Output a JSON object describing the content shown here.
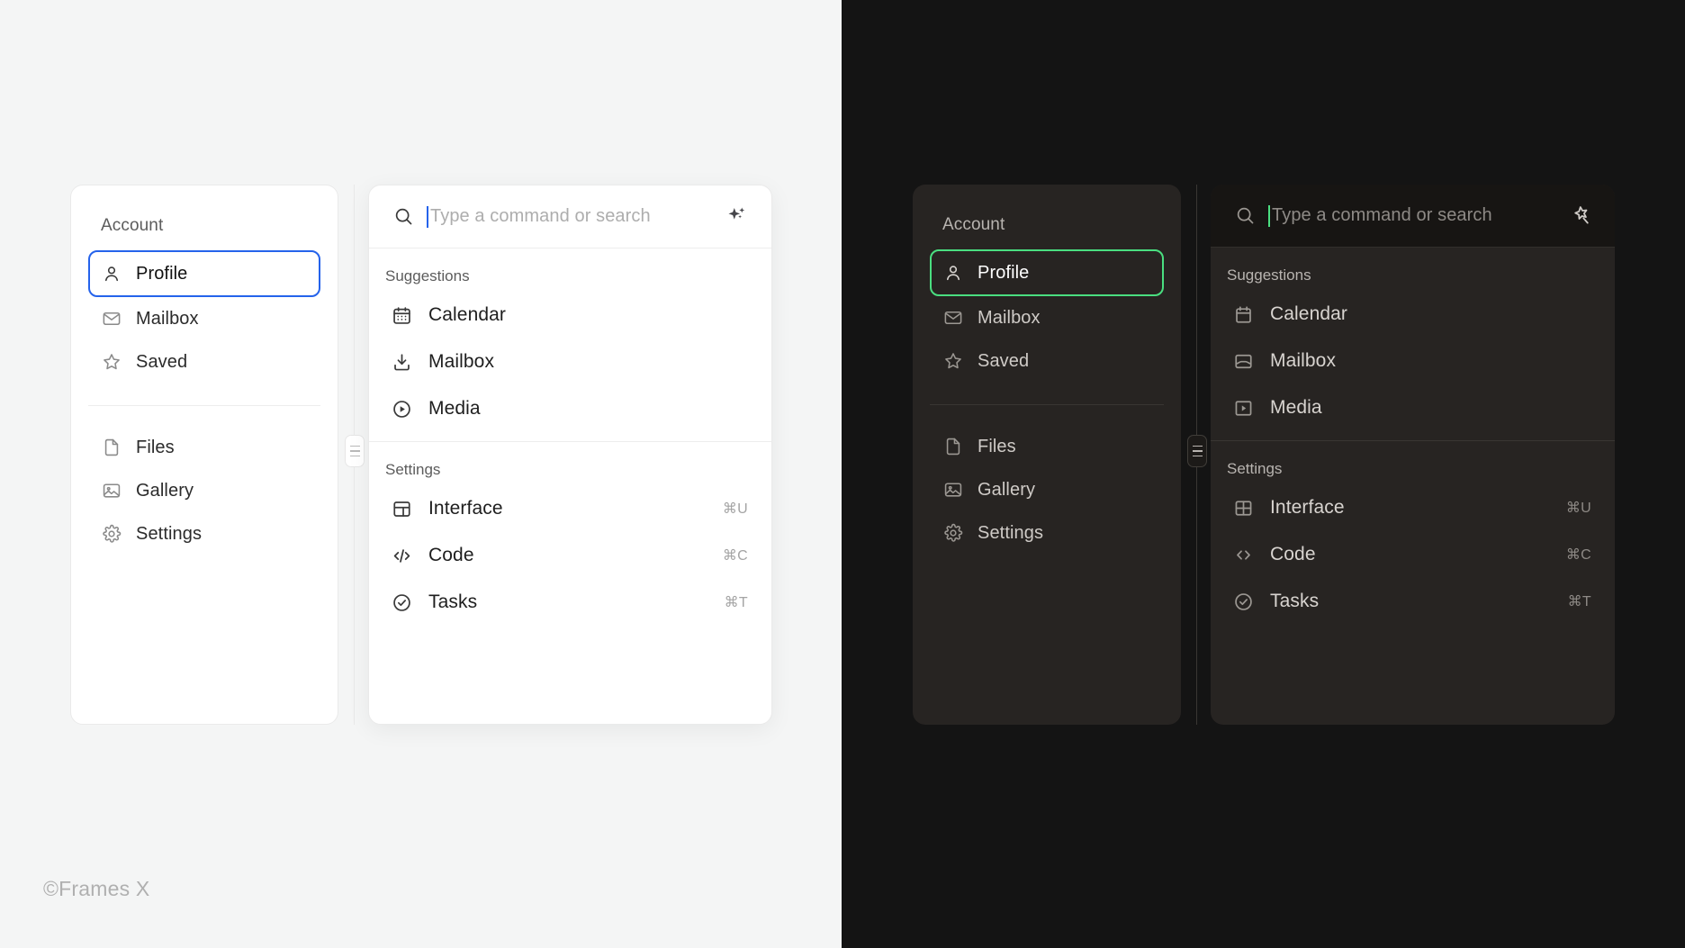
{
  "panels": {
    "light": {
      "theme_name": "light",
      "accent": "#2563EB",
      "background": "#F4F5F5",
      "sidebar": {
        "title": "Account",
        "group_a": [
          {
            "label": "Profile",
            "icon": "user-icon",
            "selected": true
          },
          {
            "label": "Mailbox",
            "icon": "envelope-icon",
            "selected": false
          },
          {
            "label": "Saved",
            "icon": "star-icon",
            "selected": false
          }
        ],
        "group_b": [
          {
            "label": "Files",
            "icon": "file-icon"
          },
          {
            "label": "Gallery",
            "icon": "image-icon"
          },
          {
            "label": "Settings",
            "icon": "gear-icon"
          }
        ]
      },
      "command": {
        "search_placeholder": "Type a command or search",
        "search_value": "",
        "search_icon": "search-icon",
        "action_icon": "sparkles-icon",
        "groups": [
          {
            "heading": "Suggestions",
            "items": [
              {
                "label": "Calendar",
                "icon": "calendar-icon",
                "shortcut": ""
              },
              {
                "label": "Mailbox",
                "icon": "download-icon",
                "shortcut": ""
              },
              {
                "label": "Media",
                "icon": "play-circle-icon",
                "shortcut": ""
              }
            ]
          },
          {
            "heading": "Settings",
            "items": [
              {
                "label": "Interface",
                "icon": "layout-icon",
                "shortcut": "⌘U"
              },
              {
                "label": "Code",
                "icon": "code-icon",
                "shortcut": "⌘C"
              },
              {
                "label": "Tasks",
                "icon": "check-circle-icon",
                "shortcut": "⌘T"
              }
            ]
          }
        ]
      },
      "resize_handle": "drag-handle-icon"
    },
    "dark": {
      "theme_name": "dark",
      "accent": "#4ADE80",
      "background": "#141414",
      "sidebar": {
        "title": "Account",
        "group_a": [
          {
            "label": "Profile",
            "icon": "user-icon",
            "selected": true
          },
          {
            "label": "Mailbox",
            "icon": "envelope-icon",
            "selected": false
          },
          {
            "label": "Saved",
            "icon": "star-icon",
            "selected": false
          }
        ],
        "group_b": [
          {
            "label": "Files",
            "icon": "file-icon"
          },
          {
            "label": "Gallery",
            "icon": "image-icon"
          },
          {
            "label": "Settings",
            "icon": "gear-icon"
          }
        ]
      },
      "command": {
        "search_placeholder": "Type a command or search",
        "search_value": "",
        "search_icon": "search-icon",
        "action_icon": "magic-star-icon",
        "groups": [
          {
            "heading": "Suggestions",
            "items": [
              {
                "label": "Calendar",
                "icon": "calendar-icon",
                "shortcut": ""
              },
              {
                "label": "Mailbox",
                "icon": "inbox-icon",
                "shortcut": ""
              },
              {
                "label": "Media",
                "icon": "play-square-icon",
                "shortcut": ""
              }
            ]
          },
          {
            "heading": "Settings",
            "items": [
              {
                "label": "Interface",
                "icon": "grid-icon",
                "shortcut": "⌘U"
              },
              {
                "label": "Code",
                "icon": "chevrons-icon",
                "shortcut": "⌘C"
              },
              {
                "label": "Tasks",
                "icon": "check-circle-icon",
                "shortcut": "⌘T"
              }
            ]
          }
        ]
      },
      "resize_handle": "drag-handle-icon"
    }
  },
  "watermark": "©Frames X"
}
